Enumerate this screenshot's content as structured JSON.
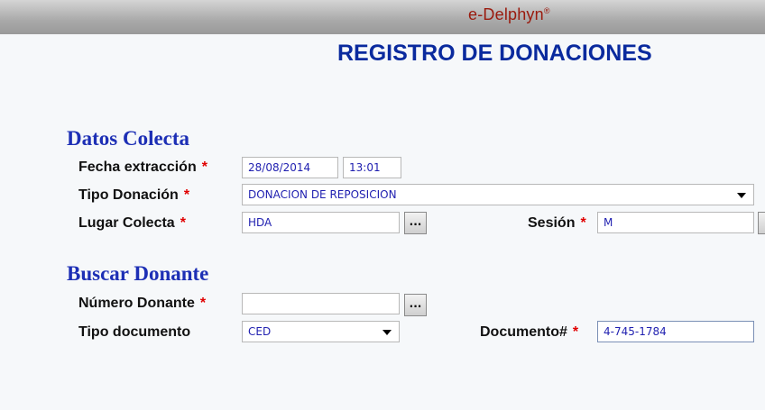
{
  "header": {
    "brand": "e-Delphyn",
    "brand_mark": "®"
  },
  "page_title": "REGISTRO DE DONACIONES",
  "required_mark": "*",
  "lookup_label": "...",
  "datos_colecta": {
    "title": "Datos Colecta",
    "fecha_label": "Fecha extracción",
    "fecha_value": "28/08/2014",
    "hora_value": "13:01",
    "tipo_label": "Tipo Donación",
    "tipo_value": "DONACION DE REPOSICION",
    "lugar_label": "Lugar Colecta",
    "lugar_value": "HDA",
    "sesion_label": "Sesión",
    "sesion_value": "M"
  },
  "buscar_donante": {
    "title": "Buscar Donante",
    "numero_label": "Número Donante",
    "numero_value": "",
    "tipo_doc_label": "Tipo documento",
    "tipo_doc_value": "CED",
    "documento_label": "Documento#",
    "documento_value": "4-745-1784"
  },
  "icons": {
    "dropdown": "chevron-down-icon"
  }
}
